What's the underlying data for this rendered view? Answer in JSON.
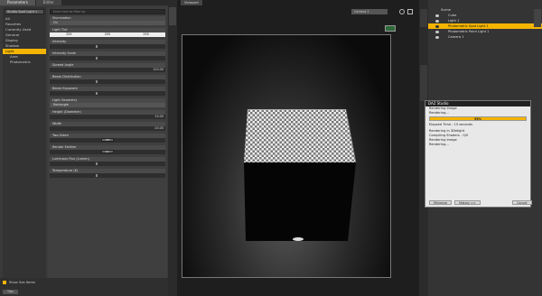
{
  "left_tabs": [
    "Parameters",
    "Editor"
  ],
  "node_select": "Studio Spot Light 1",
  "categories": [
    {
      "label": "All",
      "selected": false
    },
    {
      "label": "Favorites",
      "selected": false
    },
    {
      "label": "Currently Used",
      "selected": false
    },
    {
      "label": "General",
      "selected": false
    },
    {
      "label": "Display",
      "selected": false
    },
    {
      "label": "Shadow",
      "selected": false
    },
    {
      "label": "Light",
      "selected": true
    },
    {
      "label": "Area",
      "selected": false
    },
    {
      "label": "Photometric",
      "selected": false
    }
  ],
  "search_placeholder": "Enter text to filter by",
  "properties": {
    "illumination": {
      "label": "Illumination",
      "value": "On"
    },
    "light_tint": {
      "label": "Light Tint",
      "r": "255",
      "g": "255",
      "b": "255"
    },
    "intensity": {
      "label": "Intensity",
      "value": ""
    },
    "intensity_scale": {
      "label": "Intensity Scale",
      "value": ""
    },
    "spread_angle": {
      "label": "Spread Angle",
      "value": "120.00"
    },
    "beam_distribution": {
      "label": "Beam Distribution",
      "value": ""
    },
    "beam_exponent": {
      "label": "Beam Exponent",
      "value": ""
    },
    "light_geometry": {
      "label": "Light Geometry",
      "value": "Rectangle"
    },
    "height": {
      "label": "Height (Diameter)",
      "value": "15.00"
    },
    "width": {
      "label": "Width",
      "value": "20.00"
    },
    "two_sided": {
      "label": "Two-Sided",
      "value": "Off"
    },
    "render_emitter": {
      "label": "Render Emitter",
      "value": "On"
    },
    "luminous_flux": {
      "label": "Luminous Flux (Lumen)",
      "value": ""
    },
    "temperature": {
      "label": "Temperature (K)",
      "value": ""
    }
  },
  "show_sub_items": "Show Sub Items",
  "tips_label": "Tips",
  "viewport": {
    "tab": "Viewport",
    "camera": "Camera 1"
  },
  "right_tabs": [
    "Scene"
  ],
  "scene_items": [
    {
      "label": "Scene",
      "selected": false
    },
    {
      "label": "Cube",
      "selected": false
    },
    {
      "label": "Light 1",
      "selected": false
    },
    {
      "label": "Photometric Spot Light 1",
      "selected": true
    },
    {
      "label": "Photometric Point Light 1",
      "selected": false
    },
    {
      "label": "Camera 1",
      "selected": false
    }
  ],
  "render_dialog": {
    "title": "DAZ Studio",
    "heading": "Rendering Image",
    "status": "Rendering...",
    "percent": "93%",
    "progress": 0.93,
    "elapsed": "Elapsed Time : 15 seconds",
    "log": [
      "Rendering in 3Delight",
      "Compiling Shaders - 0/0",
      "Rendering Image",
      "Rendering..."
    ],
    "minimize": "Minimize",
    "history": "History >>",
    "cancel": "Cancel"
  },
  "colors": {
    "accent": "#f4b400"
  }
}
